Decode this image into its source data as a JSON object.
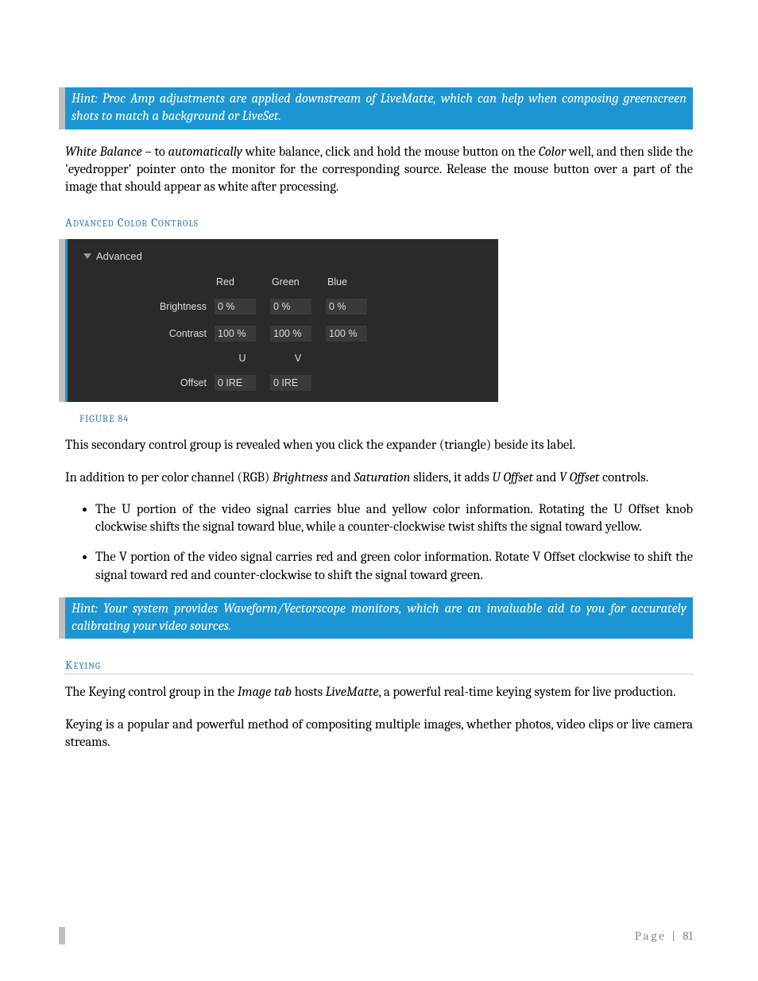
{
  "hint1": "Hint: Proc Amp adjustments are applied downstream of LiveMatte, which can help when composing greenscreen shots to match a background or LiveSet.",
  "wb": {
    "lead_ital": "White Balance",
    "dash": " – to ",
    "auto_ital": "automatically",
    "mid": " white balance, click and hold the mouse button on the ",
    "color_ital": "Color",
    "rest": " well, and then slide the 'eyedropper' pointer onto the monitor for the corresponding source.  Release the mouse button over a part of the image that should appear as white after processing."
  },
  "sec_adv": "Advanced Color Controls",
  "screenshot": {
    "title": "Advanced",
    "cols_rgb": [
      "Red",
      "Green",
      "Blue"
    ],
    "rows_rgb": [
      {
        "label": "Brightness",
        "vals": [
          "0  %",
          "0  %",
          "0  %"
        ]
      },
      {
        "label": "Contrast",
        "vals": [
          "100  %",
          "100  %",
          "100  %"
        ]
      }
    ],
    "cols_uv": [
      "U",
      "V"
    ],
    "rows_uv": [
      {
        "label": "Offset",
        "vals": [
          "0  IRE",
          "0  IRE"
        ]
      }
    ]
  },
  "figcap": "FIGURE 84",
  "p_after_fig": "This secondary control group is revealed when you click the expander (triangle) beside its label.",
  "p_inaddition": {
    "pre": "In addition to per color channel (RGB) ",
    "b_ital": "Brightness",
    "and": " and ",
    "s_ital": "Saturation",
    "mid": " sliders, it adds ",
    "u_ital": "U Offset",
    "and2": " and ",
    "v_ital": "V Offset",
    "post": " controls."
  },
  "bullet_u": {
    "pre": "The U portion of the video signal carries blue and yellow color information. Rotating the ",
    "ital": "U Offset knob",
    "post": " clockwise shifts the signal toward blue, while a counter-clockwise twist shifts the signal toward yellow."
  },
  "bullet_v": {
    "pre": "The V portion of the video signal carries red and green color information. Rotate ",
    "ital": "V Offset",
    "post": " clockwise to shift the signal toward red and counter-clockwise to shift the signal toward green."
  },
  "hint2": "Hint: Your system provides Waveform/Vectorscope monitors, which are an invaluable aid to you for accurately calibrating your video sources.",
  "sec_key": "Keying",
  "p_key1": {
    "pre": "The Keying control group in the ",
    "it1": "Image tab",
    "mid": " hosts ",
    "it2": "LiveMatte",
    "post": ", a powerful real-time keying system for live production."
  },
  "p_key2": "Keying is a popular and powerful method of compositing multiple images, whether photos, video clips or live camera streams.",
  "footer": {
    "label": "Page",
    "sep": " | ",
    "num": "81"
  }
}
